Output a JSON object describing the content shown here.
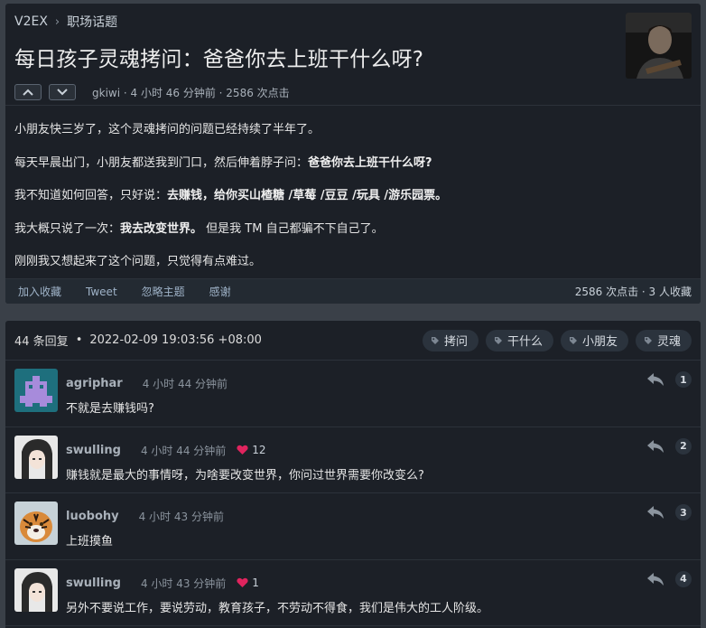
{
  "breadcrumb": {
    "site": "V2EX",
    "sep": "›",
    "node": "职场话题"
  },
  "topic": {
    "title": "每日孩子灵魂拷问：爸爸你去上班干什么呀?",
    "author": "gkiwi",
    "meta": " · 4 小时 46 分钟前 · 2586 次点击",
    "body": {
      "p1": "小朋友快三岁了，这个灵魂拷问的问题已经持续了半年了。",
      "p2_a": "每天早晨出门，小朋友都送我到门口，然后伸着脖子问：",
      "p2_b": "爸爸你去上班干什么呀?",
      "p3_a": "我不知道如何回答，只好说：",
      "p3_b": "去赚钱，给你买山楂糖 /草莓 /豆豆 /玩具 /游乐园票。",
      "p4_a": "我大概只说了一次：",
      "p4_b": "我去改变世界。",
      "p4_c": " 但是我 TM 自己都骗不下自己了。",
      "p5": "刚刚我又想起来了这个问题，只觉得有点难过。"
    },
    "actions": {
      "favorite": "加入收藏",
      "tweet": "Tweet",
      "ignore": "忽略主题",
      "thanks": "感谢"
    },
    "stats": "2586 次点击 · 3 人收藏"
  },
  "replies_header": {
    "count": "44 条回复",
    "dot": "•",
    "date": "2022-02-09 19:03:56 +08:00",
    "tags": [
      "拷问",
      "干什么",
      "小朋友",
      "灵魂"
    ]
  },
  "replies": [
    {
      "user": "agriphar",
      "ago": "4 小时 44 分钟前",
      "likes": "",
      "content": "不就是去赚钱吗?",
      "floor": "1"
    },
    {
      "user": "swulling",
      "ago": "4 小时 44 分钟前",
      "likes": "12",
      "content": "赚钱就是最大的事情呀，为啥要改变世界，你问过世界需要你改变么?",
      "floor": "2"
    },
    {
      "user": "luobohy",
      "ago": "4 小时 43 分钟前",
      "likes": "",
      "content": "上班摸鱼",
      "floor": "3"
    },
    {
      "user": "swulling",
      "ago": "4 小时 43 分钟前",
      "likes": "1",
      "content": "另外不要说工作，要说劳动，教育孩子，不劳动不得食，我们是伟大的工人阶级。",
      "floor": "4"
    }
  ],
  "colors": {
    "box_bg": "#1c2027",
    "page_bg": "#3a4048",
    "heart": "#e0245e",
    "link": "#9fb3c8"
  }
}
